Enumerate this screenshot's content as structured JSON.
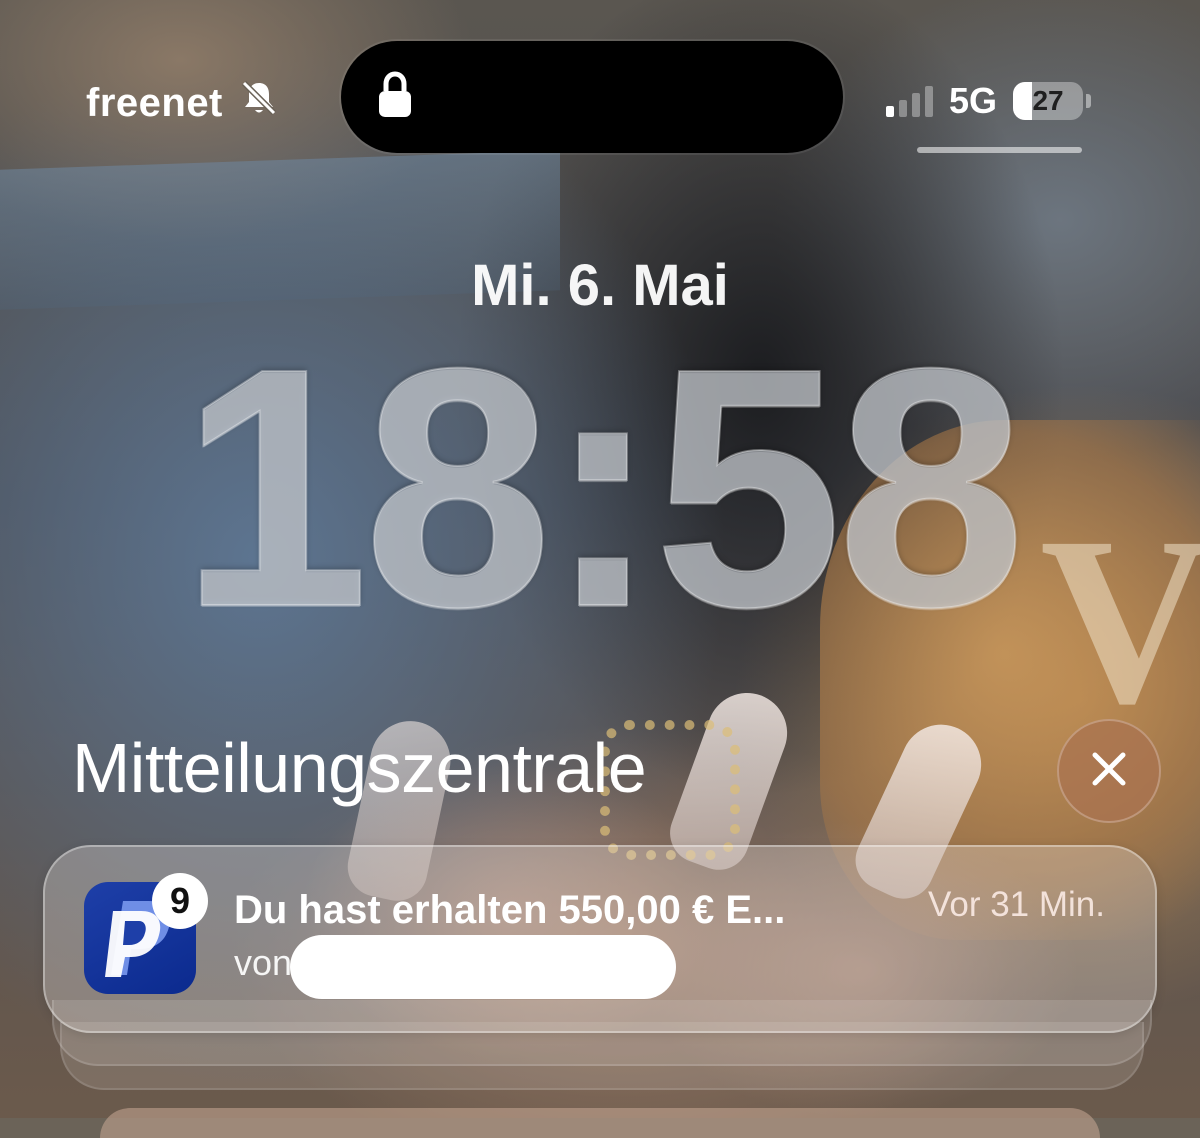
{
  "status_bar": {
    "carrier": "freenet",
    "network": "5G",
    "battery_level": "27",
    "icons": [
      "bell-slash-icon",
      "lock-icon",
      "signal-icon",
      "battery-icon"
    ]
  },
  "lock_screen": {
    "date": "Mi. 6. Mai",
    "time": "18:58"
  },
  "notification_center": {
    "title": "Mitteilungszentrale",
    "close_icon": "close-icon",
    "notifications": [
      {
        "app_icon": "paypal-icon",
        "badge": "9",
        "title": "Du hast erhalten 550,00 € E...",
        "body": "von",
        "time": "Vor 31 Min."
      }
    ]
  }
}
